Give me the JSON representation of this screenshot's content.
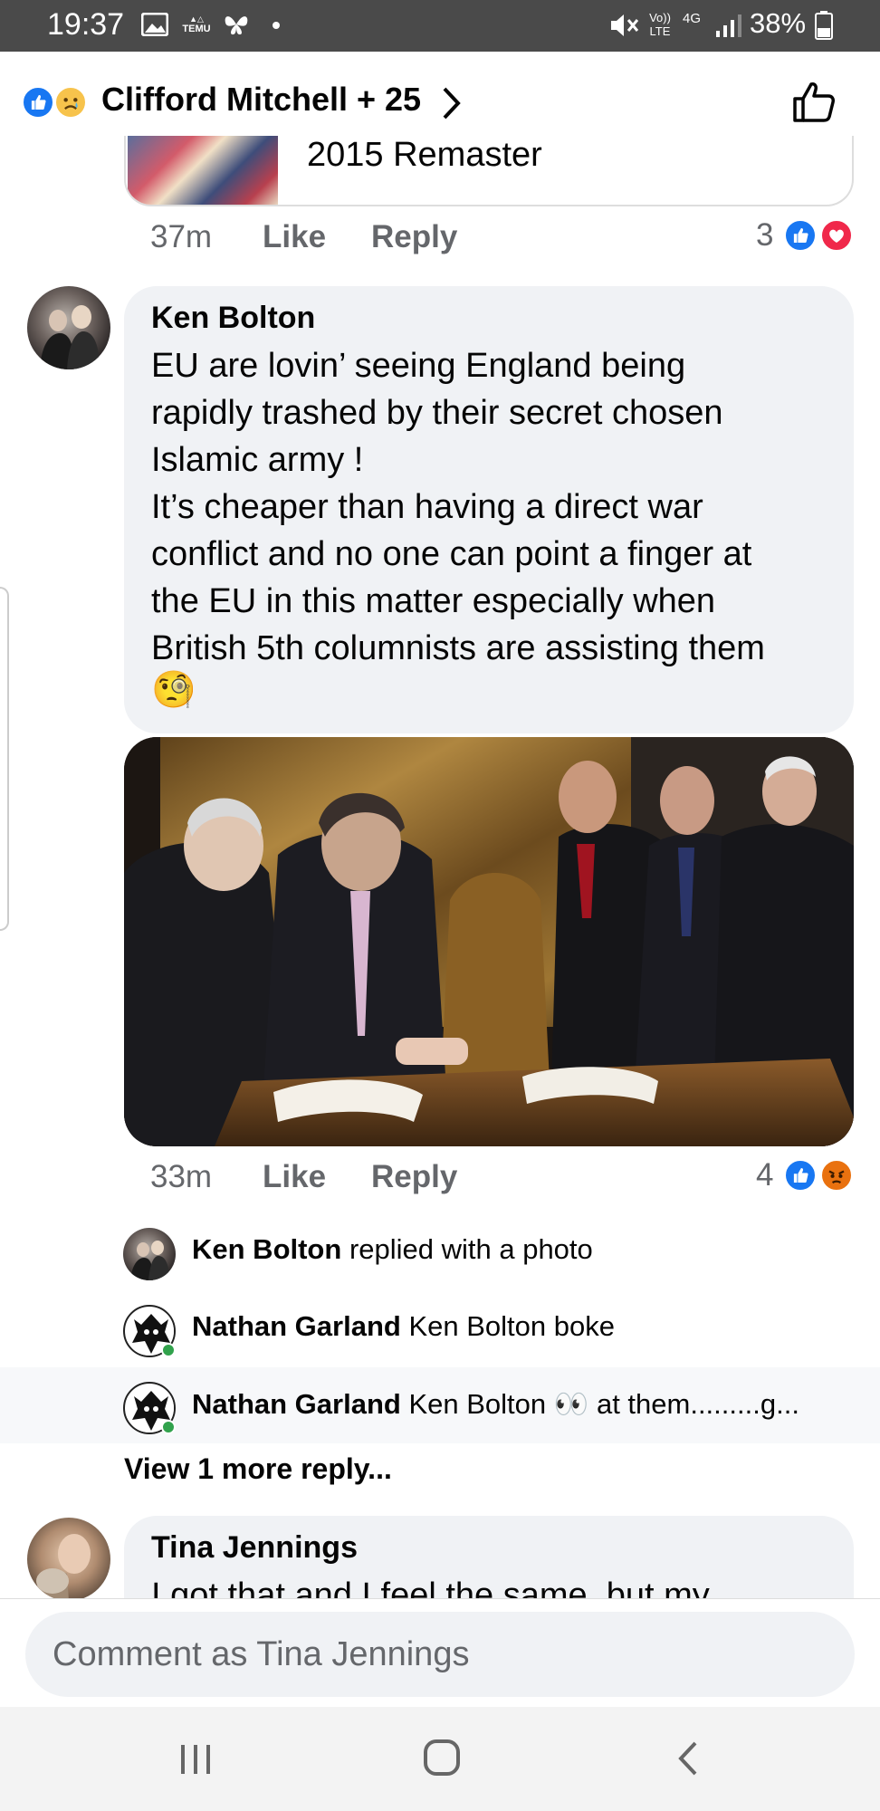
{
  "status_bar": {
    "time": "19:37",
    "left_icons": [
      "image-icon",
      "temu-icon",
      "butterfly-icon",
      "dot-icon"
    ],
    "temu_label": "TEMU",
    "battery": "38%",
    "network": "4G",
    "volte": "Vo)) LTE"
  },
  "header": {
    "reactors": "Clifford Mitchell + 25",
    "reaction_icons": [
      "like-icon",
      "sad-icon"
    ]
  },
  "previous_comment": {
    "link_title": "2015 Remaster",
    "time": "37m",
    "like_label": "Like",
    "reply_label": "Reply",
    "reaction_count": "3",
    "reaction_icons": [
      "like-icon",
      "love-icon"
    ]
  },
  "comment": {
    "author": "Ken Bolton",
    "text": "EU are lovin’ seeing England being\nrapidly trashed by their secret chosen\nIslamic army !\nIt’s cheaper than having a direct war\nconflict and no one can point a finger at\nthe EU in this matter especially when\nBritish 5th columnists are assisting them",
    "emoji": "🧐",
    "time": "33m",
    "like_label": "Like",
    "reply_label": "Reply",
    "reaction_count": "4",
    "reaction_icons": [
      "like-icon",
      "angry-icon"
    ]
  },
  "replies": [
    {
      "author": "Ken Bolton",
      "text": "replied with a photo"
    },
    {
      "author": "Nathan Garland",
      "text": "Ken Bolton boke"
    },
    {
      "author": "Nathan Garland",
      "text": "Ken Bolton 👀 at them.........g..."
    }
  ],
  "view_more": "View 1 more reply...",
  "next_comment": {
    "author": "Tina Jennings",
    "text_partial": "I got that and I feel the same, but my"
  },
  "composer": {
    "placeholder": "Comment as Tina Jennings"
  },
  "colors": {
    "facebook_blue": "#1877f2",
    "bubble_gray": "#f0f2f5",
    "meta_gray": "#65676b",
    "status_bar": "#4a4a4a"
  }
}
